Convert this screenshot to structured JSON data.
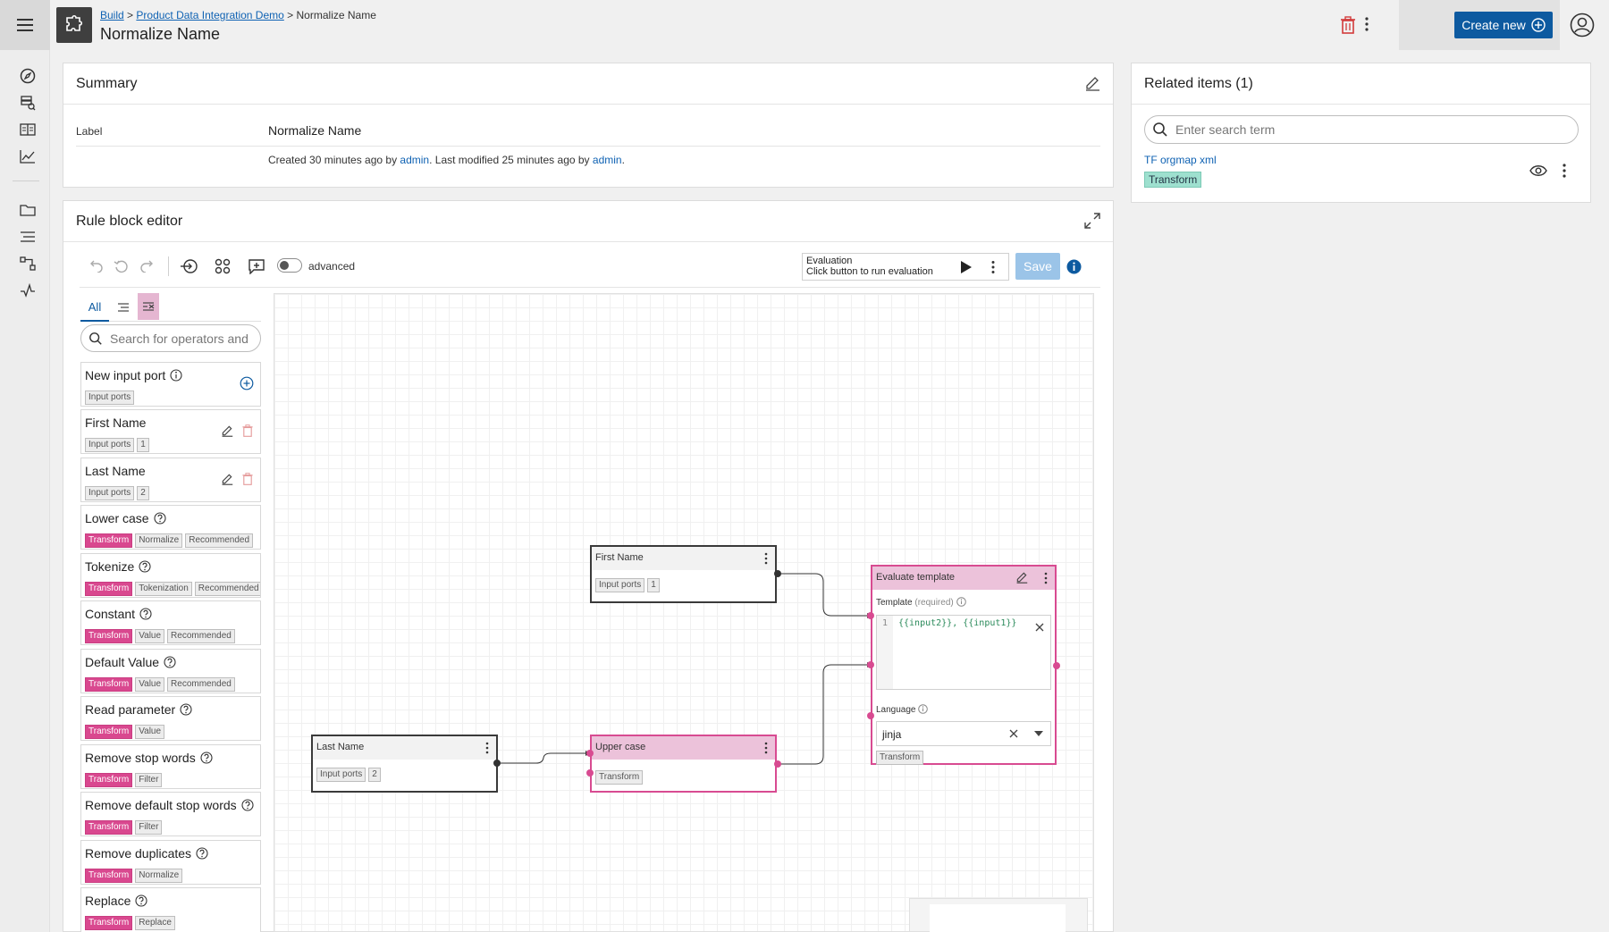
{
  "header": {
    "breadcrumb": [
      "Build",
      "Product Data Integration Demo",
      "Normalize Name"
    ],
    "breadcrumb_sep": ">",
    "title": "Normalize Name",
    "create_label": "Create new"
  },
  "summary": {
    "title": "Summary",
    "label_key": "Label",
    "label_value": "Normalize Name",
    "meta": {
      "created": "Created 30 minutes ago by ",
      "created_by": "admin",
      "modified": ". Last modified 25 minutes ago by ",
      "modified_by": "admin",
      "end": "."
    }
  },
  "related": {
    "title": "Related items (1)",
    "search_placeholder": "Enter search term",
    "items": [
      {
        "name": "TF orgmap xml",
        "tag": "Transform"
      }
    ]
  },
  "editor": {
    "title": "Rule block editor",
    "advanced_label": "advanced",
    "evaluation_title": "Evaluation",
    "evaluation_hint": "Click button to run evaluation",
    "save_label": "Save",
    "filter_all": "All",
    "search_placeholder": "Search for operators and"
  },
  "operators": [
    {
      "name": "New input port",
      "icon": "info-icon",
      "tags": [
        {
          "t": "Input ports",
          "pink": false
        }
      ],
      "action": "add"
    },
    {
      "name": "First Name",
      "tags": [
        {
          "t": "Input ports",
          "pink": false
        },
        {
          "t": "1",
          "pink": false
        }
      ],
      "action": "edit"
    },
    {
      "name": "Last Name",
      "tags": [
        {
          "t": "Input ports",
          "pink": false
        },
        {
          "t": "2",
          "pink": false
        }
      ],
      "action": "edit"
    },
    {
      "name": "Lower case",
      "icon": "help-icon",
      "tags": [
        {
          "t": "Transform",
          "pink": true
        },
        {
          "t": "Normalize",
          "pink": false
        },
        {
          "t": "Recommended",
          "pink": false
        }
      ]
    },
    {
      "name": "Tokenize",
      "icon": "help-icon",
      "tags": [
        {
          "t": "Transform",
          "pink": true
        },
        {
          "t": "Tokenization",
          "pink": false
        },
        {
          "t": "Recommended",
          "pink": false
        }
      ]
    },
    {
      "name": "Constant",
      "icon": "help-icon",
      "tags": [
        {
          "t": "Transform",
          "pink": true
        },
        {
          "t": "Value",
          "pink": false
        },
        {
          "t": "Recommended",
          "pink": false
        }
      ]
    },
    {
      "name": "Default Value",
      "icon": "help-icon",
      "tags": [
        {
          "t": "Transform",
          "pink": true
        },
        {
          "t": "Value",
          "pink": false
        },
        {
          "t": "Recommended",
          "pink": false
        }
      ]
    },
    {
      "name": "Read parameter",
      "icon": "help-icon",
      "tags": [
        {
          "t": "Transform",
          "pink": true
        },
        {
          "t": "Value",
          "pink": false
        }
      ]
    },
    {
      "name": "Remove stop words",
      "icon": "help-icon",
      "tags": [
        {
          "t": "Transform",
          "pink": true
        },
        {
          "t": "Filter",
          "pink": false
        }
      ]
    },
    {
      "name": "Remove default stop words",
      "icon": "help-icon",
      "tags": [
        {
          "t": "Transform",
          "pink": true
        },
        {
          "t": "Filter",
          "pink": false
        }
      ]
    },
    {
      "name": "Remove duplicates",
      "icon": "help-icon",
      "tags": [
        {
          "t": "Transform",
          "pink": true
        },
        {
          "t": "Normalize",
          "pink": false
        }
      ]
    },
    {
      "name": "Replace",
      "icon": "help-icon",
      "tags": [
        {
          "t": "Transform",
          "pink": true
        },
        {
          "t": "Replace",
          "pink": false
        }
      ]
    }
  ],
  "canvas": {
    "first_name": {
      "title": "First Name",
      "tags": [
        "Input ports",
        "1"
      ]
    },
    "last_name": {
      "title": "Last Name",
      "tags": [
        "Input ports",
        "2"
      ]
    },
    "upper_case": {
      "title": "Upper case",
      "tags": [
        "Transform"
      ]
    },
    "evaluate": {
      "title": "Evaluate template",
      "template_label": "Template",
      "template_required": "(required)",
      "line_no": "1",
      "template_value": "{{input2}}, {{input1}}",
      "language_label": "Language",
      "language_value": "jinja",
      "tag": "Transform"
    }
  }
}
